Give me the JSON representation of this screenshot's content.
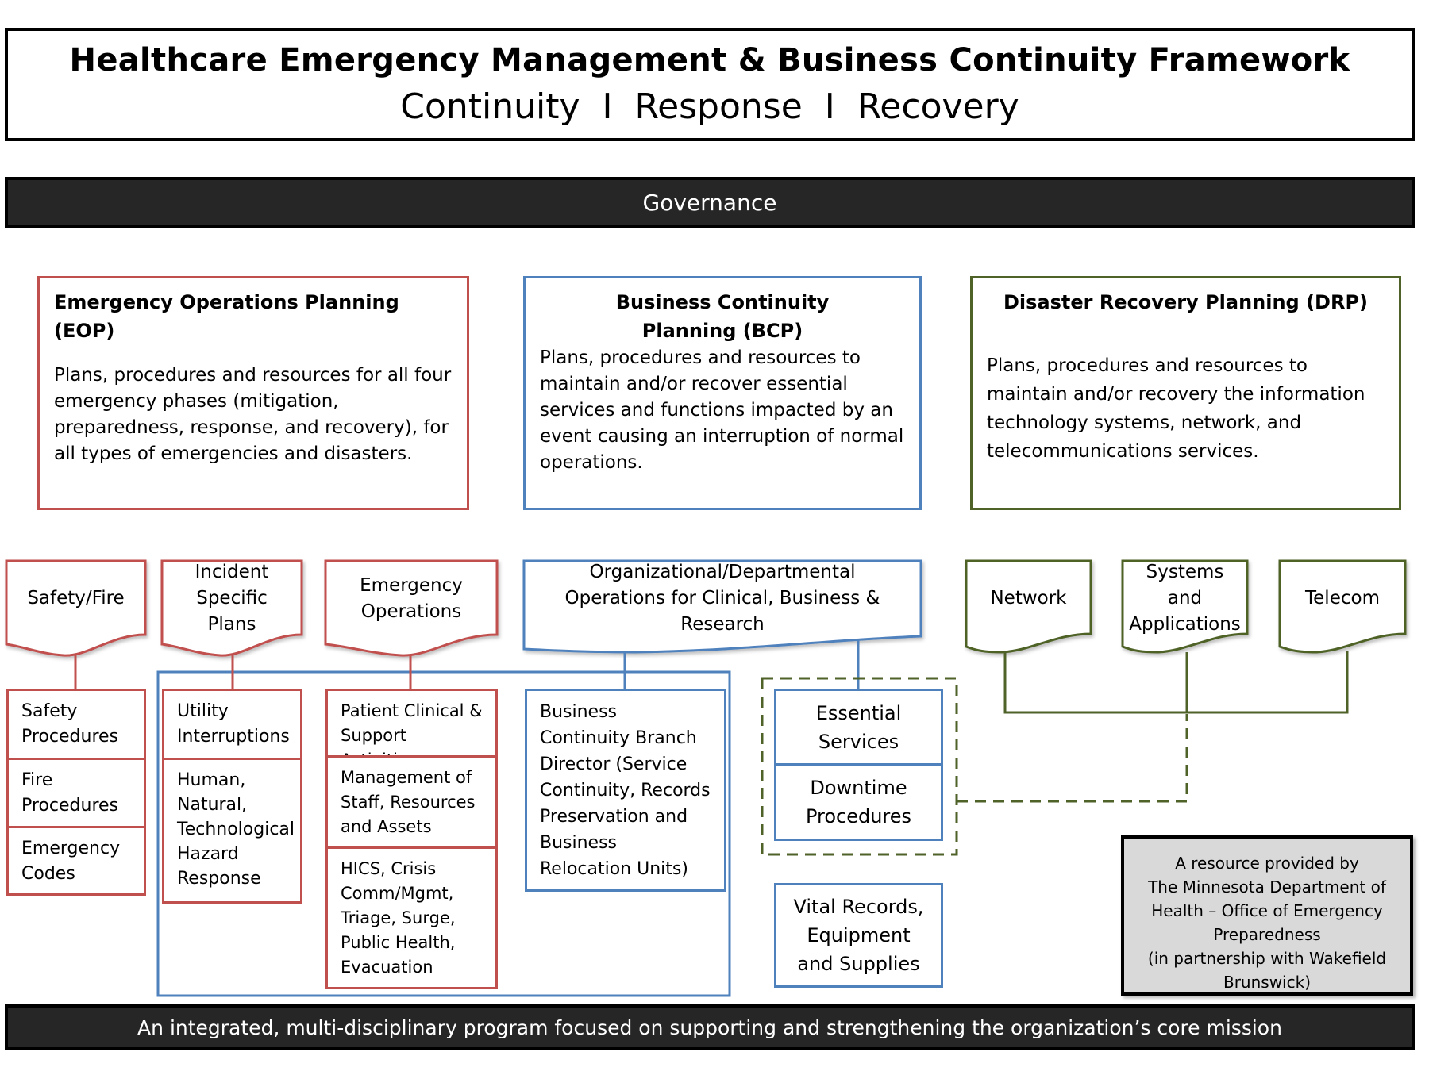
{
  "header": {
    "title": "Healthcare Emergency Management & Business Continuity Framework",
    "subtitle": "Continuity  I  Response  I  Recovery"
  },
  "governance": {
    "label": "Governance"
  },
  "colors": {
    "eop": "#C0504D",
    "bcp": "#4F81BD",
    "drp": "#4F6228",
    "bar": "#262626",
    "resource_bg": "#D9D9D9"
  },
  "plans": [
    {
      "title": "Emergency Operations Planning (EOP)",
      "description": "Plans, procedures and resources for all four emergency phases (mitigation, preparedness, response, and recovery), for all types of emergencies and disasters."
    },
    {
      "title": "Business Continuity Planning (BCP)",
      "description": "Plans, procedures and resources to maintain and/or recover essential services and functions impacted by an event causing an interruption of normal operations."
    },
    {
      "title": "Disaster Recovery Planning (DRP)",
      "description": "Plans, procedures and resources to maintain and/or recovery the information technology systems, network, and telecommunications services."
    }
  ],
  "eop_docs": [
    {
      "label": "Safety/Fire",
      "items": [
        "Safety Procedures",
        "Fire Procedures",
        "Emergency Codes"
      ]
    },
    {
      "label": "Incident Specific Plans",
      "items": [
        "Utility Interruptions",
        "Human, Natural, Technological Hazard Response"
      ]
    },
    {
      "label": "Emergency Operations",
      "items": [
        "Patient Clinical & Support Activities",
        "Management of Staff, Resources and Assets",
        "HICS, Crisis Comm/Mgmt, Triage, Surge, Public Health, Evacuation"
      ]
    }
  ],
  "bcp_doc": {
    "label": "Organizational/Departmental Operations for Clinical, Business & Research",
    "branch": "Business Continuity Branch Director (Service Continuity, Records Preservation and Business Relocation Units)",
    "essential": "Essential Services",
    "downtime": "Downtime Procedures",
    "vital": "Vital Records, Equipment and Supplies"
  },
  "drp_docs": [
    {
      "label": "Network"
    },
    {
      "label": "Systems and Applications"
    },
    {
      "label": "Telecom"
    }
  ],
  "resource": {
    "lines": [
      "A resource provided by",
      "The Minnesota Department of",
      "Health – Office of Emergency",
      "Preparedness",
      "(in partnership with Wakefield",
      "Brunswick)"
    ]
  },
  "mission": {
    "label": "An integrated, multi-disciplinary program focused on supporting and strengthening the organization’s core mission"
  }
}
